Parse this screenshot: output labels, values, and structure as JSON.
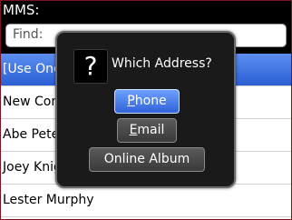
{
  "header": {
    "title": "MMS:"
  },
  "find": {
    "label": "Find:"
  },
  "contacts": [
    {
      "name": "[Use Once]"
    },
    {
      "name": "New Contact"
    },
    {
      "name": "Abe Peterson"
    },
    {
      "name": "Joey Knight"
    },
    {
      "name": "Lester Murphy"
    }
  ],
  "dialog": {
    "icon": "question-icon",
    "icon_glyph": "?",
    "prompt": "Which Address?",
    "buttons": {
      "phone": {
        "mnemonic": "P",
        "rest": "hone"
      },
      "email": {
        "mnemonic": "E",
        "rest": "mail"
      },
      "album": {
        "label": "Online Album"
      }
    }
  },
  "colors": {
    "selection": "#2a5fd4",
    "focus_button": "#3f74e6",
    "dialog_bg": "#1a1a1a"
  }
}
